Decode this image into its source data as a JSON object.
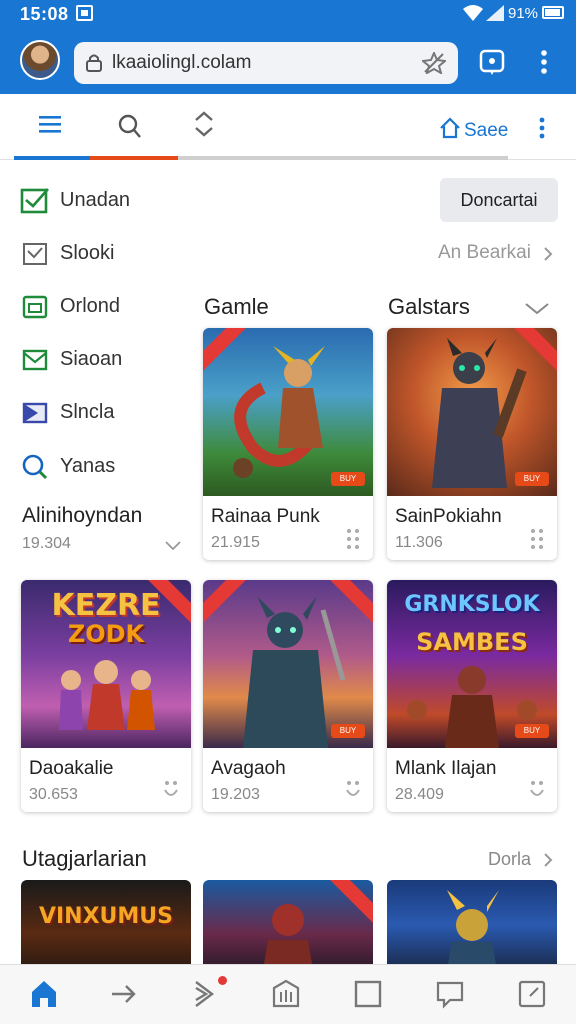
{
  "status": {
    "time": "15:08",
    "battery": "91%"
  },
  "browser": {
    "url": "lkaaiolingl.colam"
  },
  "toolbar": {
    "save_label": "Saee"
  },
  "sidebar": {
    "items": [
      {
        "label": "Unadan",
        "icon": "check-square-icon",
        "color": "#1e8a3a"
      },
      {
        "label": "Slooki",
        "icon": "checkbox-icon",
        "color": "#666666"
      },
      {
        "label": "Orlond",
        "icon": "calendar-icon",
        "color": "#1e8a3a"
      },
      {
        "label": "Siaoan",
        "icon": "mail-icon",
        "color": "#1e8a3a"
      },
      {
        "label": "Slncla",
        "icon": "send-icon",
        "color": "#3949ab"
      },
      {
        "label": "Yanas",
        "icon": "search-icon",
        "color": "#1565c0"
      }
    ],
    "sub": {
      "title": "Alinihoyndan",
      "count": "19.304"
    }
  },
  "actions": {
    "download_label": "Doncartai",
    "see_all": "An Bearkai"
  },
  "section": {
    "left_title": "Gamle",
    "right_title": "Galstars"
  },
  "cards": [
    {
      "name": "Rainaa Punk",
      "num": "21.915",
      "tag": "BUY"
    },
    {
      "name": "SainPokiahn",
      "num": "11.306",
      "tag": "BUY"
    },
    {
      "name": "Daoakalie",
      "num": "30.653",
      "logo1": "KEZRE",
      "logo2": "ZODK"
    },
    {
      "name": "Avagaoh",
      "num": "19.203",
      "tag": "BUY"
    },
    {
      "name": "Mlank Ilajan",
      "num": "28.409",
      "logo1": "GRNKSLOK",
      "logo2": "SAMBES",
      "tag": "BUY"
    }
  ],
  "bottom_section": {
    "title": "Utagjarlarian",
    "more": "Dorla",
    "card1_logo": "VINXUMUS"
  },
  "colors": {
    "brand": "#1976d2",
    "tab_active": "#1976d2",
    "tab_second": "#e64a19"
  }
}
